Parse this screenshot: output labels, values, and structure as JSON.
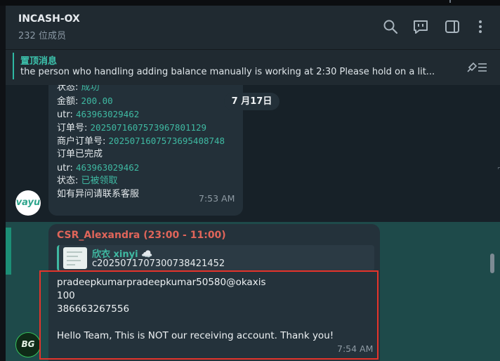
{
  "header": {
    "title": "INCASH-OX",
    "members": "232 位成员",
    "icons": [
      "search-icon",
      "comment-icon",
      "sidebar-toggle-icon",
      "more-vertical-icon"
    ]
  },
  "pinned": {
    "title": "置顶消息",
    "text": "the person who handling adding balance manually is working at 2:30  Please hold on a lit...",
    "icon": "unpin-list-icon"
  },
  "date_divider": "7 月17日",
  "message1": {
    "lines": [
      {
        "label": "状态: ",
        "value": "成功",
        "value_style": "text"
      },
      {
        "label": "金额: ",
        "value": "200.00",
        "value_style": "mono"
      },
      {
        "label": "utr: ",
        "value": "463963029462",
        "value_style": "mono"
      },
      {
        "label": "订单号: ",
        "value": "2025071607573967801129",
        "value_style": "mono"
      },
      {
        "label": "商户订单号: ",
        "value": "2025071607573695408748",
        "value_style": "mono"
      },
      {
        "label": "订单已完成",
        "value": "",
        "value_style": "text"
      },
      {
        "label": "utr: ",
        "value": "463963029462",
        "value_style": "mono"
      },
      {
        "label": "状态: ",
        "value": "已被领取",
        "value_style": "text"
      },
      {
        "label": "如有异问请联系客服",
        "value": "",
        "value_style": "text"
      }
    ],
    "time": "7:53 AM",
    "avatar_text": "vayu"
  },
  "message2": {
    "sender": "CSR_Alexandra (23:00 - 11:00)",
    "reply": {
      "name": "欣衣 xinyi ☁️",
      "text": "c202507170730073842145​2"
    },
    "lines": [
      "pradeepkumarpradeepkumar50580@okaxis",
      "100",
      "386663267556",
      "",
      "Hello Team, This is NOT our receiving account. Thank you!"
    ],
    "time": "7:54 AM",
    "avatar_text": "BG"
  },
  "colors": {
    "accent": "#3fb9a2",
    "sender": "#e0655a",
    "highlight_box": "#e5342b"
  }
}
